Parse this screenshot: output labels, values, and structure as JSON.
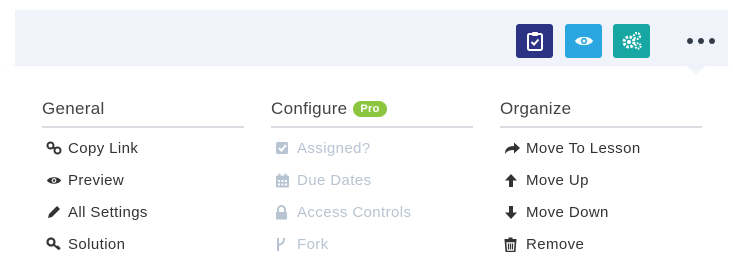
{
  "toolbar": {
    "buttons": [
      {
        "icon": "clipboard-check-icon",
        "color": "#2c3384"
      },
      {
        "icon": "eye-icon",
        "color": "#2aa7e0"
      },
      {
        "icon": "gears-icon",
        "color": "#17a7a3"
      }
    ],
    "more_icon": "ellipsis-icon"
  },
  "menu": {
    "general": {
      "heading": "General",
      "items": [
        {
          "label": "Copy Link",
          "icon": "link-icon"
        },
        {
          "label": "Preview",
          "icon": "eye-icon"
        },
        {
          "label": "All Settings",
          "icon": "pencil-icon"
        },
        {
          "label": "Solution",
          "icon": "key-icon"
        }
      ]
    },
    "configure": {
      "heading": "Configure",
      "badge": "Pro",
      "items": [
        {
          "label": "Assigned?",
          "icon": "check-square-icon",
          "disabled": true
        },
        {
          "label": "Due Dates",
          "icon": "calendar-icon",
          "disabled": true
        },
        {
          "label": "Access Controls",
          "icon": "lock-icon",
          "disabled": true
        },
        {
          "label": "Fork",
          "icon": "fork-icon",
          "disabled": true
        }
      ]
    },
    "organize": {
      "heading": "Organize",
      "items": [
        {
          "label": "Move To Lesson",
          "icon": "share-arrow-icon"
        },
        {
          "label": "Move Up",
          "icon": "arrow-up-icon"
        },
        {
          "label": "Move Down",
          "icon": "arrow-down-icon"
        },
        {
          "label": "Remove",
          "icon": "trash-icon"
        }
      ]
    }
  },
  "colors": {
    "pro_badge": "#8cc63f",
    "disabled_text": "#b8c4d2",
    "topbar_bg": "#f0f4fa"
  }
}
